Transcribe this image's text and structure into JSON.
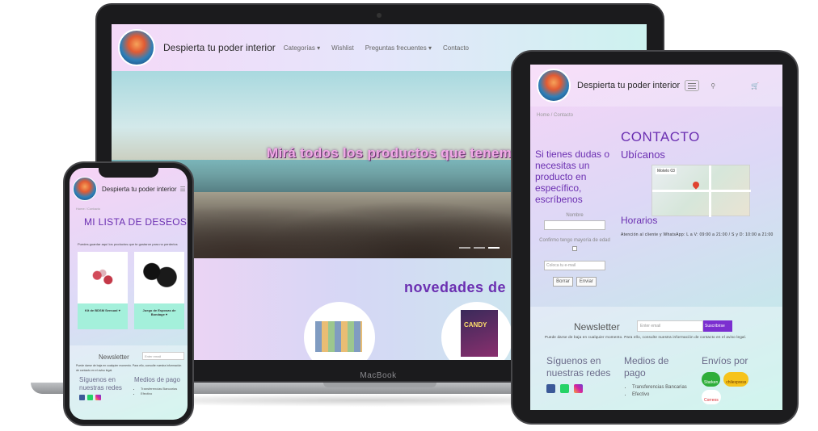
{
  "site": {
    "brand": "Despierta tu poder interior"
  },
  "laptop": {
    "device_label": "MacBook",
    "nav": [
      "Categorías ▾",
      "Wishlist",
      "Preguntas frecuentes ▾",
      "Contacto"
    ],
    "hero_text": "Mirá todos los productos que tenemos para inspirarte y escoger el producto",
    "news_title": "novedades de",
    "product_b_label": "CANDY"
  },
  "tablet": {
    "breadcrumb": "Home  /  Contacto",
    "contact_title": "CONTACTO",
    "ask_text": "Si tienes dudas o necesitas un producto en específico, escríbenos",
    "field_name_label": "Nombre",
    "field_age_label": "Confirmo tengo mayoría de edad",
    "email_placeholder": "Coloca tu e-mail",
    "btn_clear": "Borrar",
    "btn_send": "Enviar",
    "location_title": "Ubícanos",
    "map_label": "Motelo 03",
    "hours_title": "Horarios",
    "hours_text": "Atención al cliente y WhatsApp: L a V: 09:00 a 21:00 / S y D: 10:00 a 21:00",
    "newsletter_title": "Newsletter",
    "newsletter_placeholder": "Enter email",
    "newsletter_button": "Suscribirse",
    "unsubscribe_text": "Puede darse de baja en cualquier momento. Para ello, consulte nuestra información de contacto en el aviso legal.",
    "social_title": "Síguenos en nuestras redes",
    "payment_title": "Medios de pago",
    "payment_items": [
      "Transferencias Bancarias",
      "Efectivo"
    ],
    "shipping_title": "Envíos por",
    "shipping_items": [
      "Starken",
      "chilexpress",
      "Correos"
    ]
  },
  "phone": {
    "breadcrumb": "Home  /  Contacto",
    "wishlist_title": "MI LISTA DE DESEOS APHRODITE ♥",
    "wishlist_note": "Puedes guardar aquí los productos que te gustaron para no perderlos",
    "product_a": "Kit de BDSM Sensual ♥",
    "product_b": "Juego de Esposas de Bondage ♥",
    "newsletter_title": "Newsletter",
    "newsletter_placeholder": "Enter email",
    "unsubscribe_text": "Puede darse de baja en cualquier momento. Para ello, consulte nuestra información de contacto en el aviso legal.",
    "social_title": "Síguenos en nuestras redes",
    "payment_title": "Medios de pago",
    "payment_items": [
      "Transferencias Bancarias",
      "Efectivo"
    ]
  },
  "colors": {
    "accent": "#6b2fb1",
    "button": "#7b2fd0",
    "mint": "#a4f0db"
  }
}
